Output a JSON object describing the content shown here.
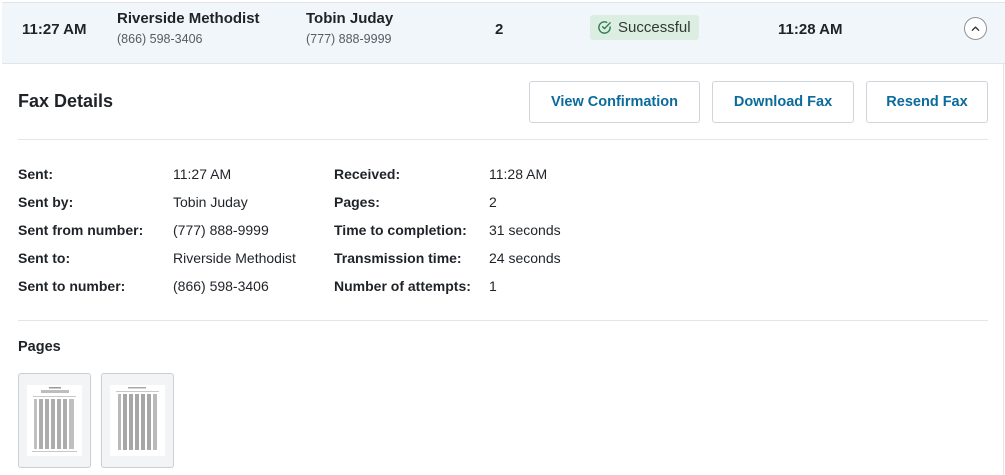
{
  "summary": {
    "sent_time": "11:27 AM",
    "recipient_name": "Riverside Methodist",
    "recipient_phone": "(866) 598-3406",
    "sender_name": "Tobin Juday",
    "sender_phone": "(777) 888-9999",
    "pages": "2",
    "status": "Successful",
    "status_color": "#dceee2",
    "completed_time": "11:28 AM",
    "collapse_icon": "chevron-up-icon"
  },
  "details": {
    "title": "Fax Details",
    "buttons": {
      "view_confirmation": "View Confirmation",
      "download_fax": "Download Fax",
      "resend_fax": "Resend Fax"
    },
    "left_fields": [
      {
        "label": "Sent:",
        "value": "11:27 AM"
      },
      {
        "label": "Sent by:",
        "value": "Tobin Juday"
      },
      {
        "label": "Sent from number:",
        "value": "(777) 888-9999"
      },
      {
        "label": "Sent to:",
        "value": "Riverside Methodist"
      },
      {
        "label": "Sent to number:",
        "value": "(866) 598-3406"
      }
    ],
    "right_fields": [
      {
        "label": "Received:",
        "value": "11:28 AM"
      },
      {
        "label": "Pages:",
        "value": "2"
      },
      {
        "label": "Time to completion:",
        "value": "31 seconds"
      },
      {
        "label": "Transmission time:",
        "value": "24 seconds"
      },
      {
        "label": "Number of attempts:",
        "value": "1"
      }
    ]
  },
  "pages_section": {
    "heading": "Pages",
    "thumbnails": [
      "page-1",
      "page-2"
    ]
  },
  "colors": {
    "accent": "#0a6b9c",
    "success_icon": "#2e7d4f",
    "row_background": "#f1f6fa"
  }
}
